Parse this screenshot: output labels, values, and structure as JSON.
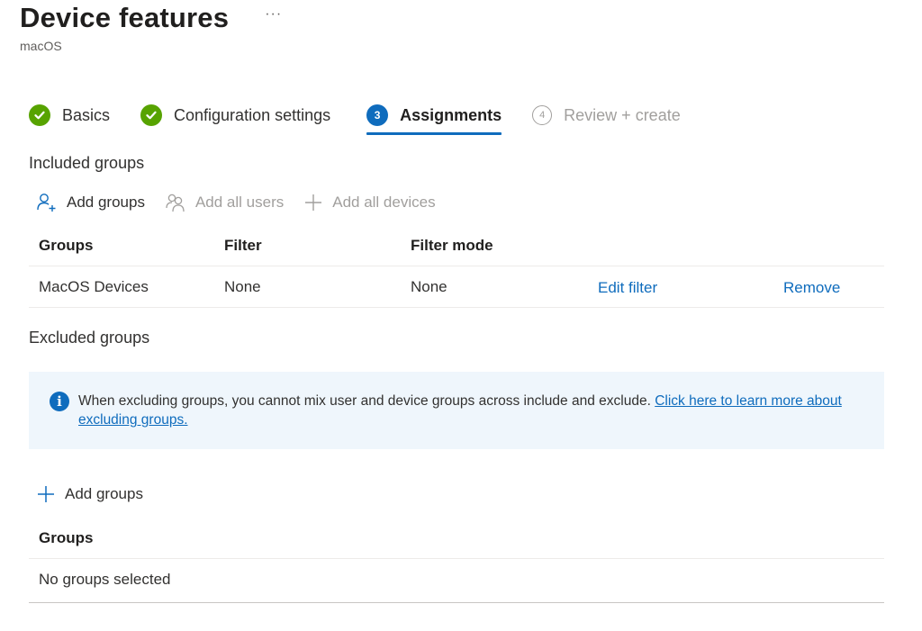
{
  "header": {
    "title": "Device features",
    "more_label": "···",
    "subtitle": "macOS"
  },
  "steps": [
    {
      "label": "Basics",
      "status": "done"
    },
    {
      "label": "Configuration settings",
      "status": "done"
    },
    {
      "number": "3",
      "label": "Assignments",
      "status": "current"
    },
    {
      "number": "4",
      "label": "Review + create",
      "status": "future"
    }
  ],
  "included": {
    "title": "Included groups",
    "toolbar": {
      "add_groups": "Add groups",
      "add_all_users": "Add all users",
      "add_all_devices": "Add all devices"
    },
    "columns": [
      "Groups",
      "Filter",
      "Filter mode"
    ],
    "rows": [
      {
        "group": "MacOS Devices",
        "filter": "None",
        "filter_mode": "None",
        "edit_label": "Edit filter",
        "remove_label": "Remove"
      }
    ]
  },
  "excluded": {
    "title": "Excluded groups",
    "info": {
      "text": "When excluding groups, you cannot mix user and device groups across include and exclude.",
      "link": "Click here to learn more about excluding groups."
    },
    "add_groups": "Add groups",
    "column": "Groups",
    "empty_text": "No groups selected"
  },
  "colors": {
    "accent": "#0f6cbd",
    "success": "#57a300",
    "info_bg": "#eff6fc",
    "disabled": "#a19f9d"
  }
}
